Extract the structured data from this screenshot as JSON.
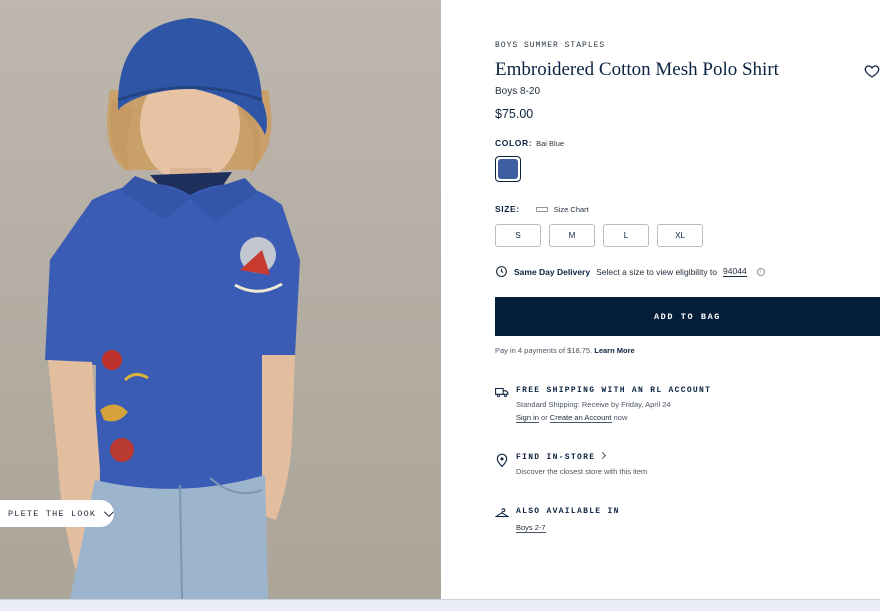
{
  "look": {
    "label": "PLETE THE LOOK"
  },
  "product": {
    "eyebrow": "BOYS SUMMER STAPLES",
    "title": "Embroidered Cotton Mesh Polo Shirt",
    "subtitle": "Boys 8-20",
    "price": "$75.00",
    "favorite_icon": "heart-icon"
  },
  "color": {
    "label": "COLOR:",
    "value": "Bai Blue",
    "swatch_hex": "#3d5ea0"
  },
  "size": {
    "label": "SIZE:",
    "chart_label": "Size Chart",
    "options": [
      "S",
      "M",
      "L",
      "XL"
    ]
  },
  "delivery": {
    "title": "Same Day Delivery",
    "text": "Select a size to view eligibility to",
    "zip": "94044"
  },
  "cart": {
    "button_label": "ADD TO BAG",
    "accent": "#041e3a"
  },
  "payment": {
    "text": "Pay in 4 payments of $18.75.",
    "link": "Learn More"
  },
  "shipping": {
    "title": "FREE SHIPPING WITH AN RL ACCOUNT",
    "line": "Standard Shipping: Receive by Friday, April 24",
    "sign_in": "Sign in",
    "or": "or",
    "create": "Create an Account",
    "now": "now"
  },
  "store": {
    "title": "FIND IN-STORE",
    "text": "Discover the closest store with this item"
  },
  "also": {
    "title": "ALSO AVAILABLE IN",
    "link": "Boys 2-7"
  }
}
